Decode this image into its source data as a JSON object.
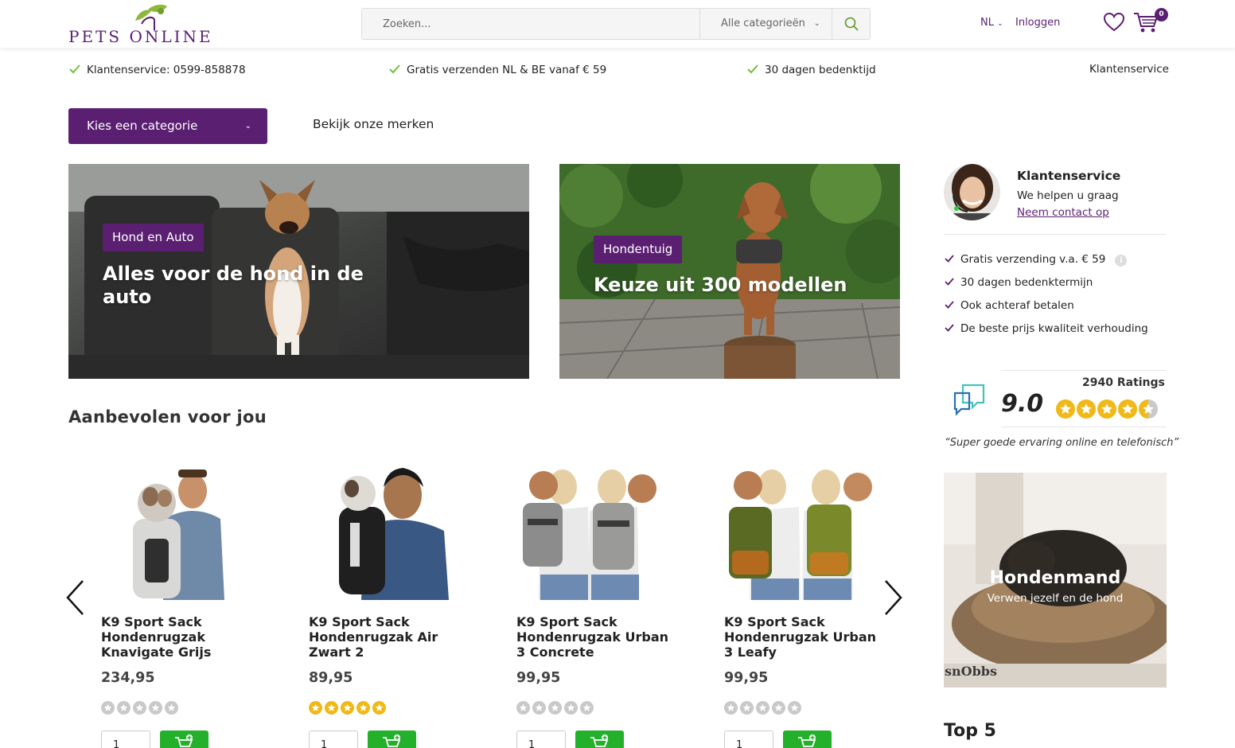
{
  "header": {
    "logo_text": "PETS ONLINE",
    "search_placeholder": "Zoeken...",
    "search_category": "Alle categorieën",
    "lang": "NL",
    "login": "Inloggen",
    "cart_count": "0"
  },
  "usp_bar": {
    "items": [
      "Klantenservice: 0599-858878",
      "Gratis verzenden NL & BE vanaf € 59",
      "30 dagen bedenktijd"
    ],
    "right_link": "Klantenservice"
  },
  "nav": {
    "category_button": "Kies een categorie",
    "brands_link": "Bekijk onze merken"
  },
  "banners": [
    {
      "label": "Hond en Auto",
      "title": "Alles voor de hond in de auto"
    },
    {
      "label": "Hondentuig",
      "title": "Keuze uit 300 modellen"
    }
  ],
  "recommended": {
    "title": "Aanbevolen voor jou",
    "products": [
      {
        "name": "K9 Sport Sack Hondenrugzak Knavigate Grijs",
        "price": "234,95",
        "rating": 0,
        "qty": "1"
      },
      {
        "name": "K9 Sport Sack Hondenrugzak Air Zwart 2",
        "price": "89,95",
        "rating": 5,
        "qty": "1"
      },
      {
        "name": "K9 Sport Sack Hondenrugzak Urban 3 Concrete",
        "price": "99,95",
        "rating": 0,
        "qty": "1"
      },
      {
        "name": "K9 Sport Sack Hondenrugzak Urban 3 Leafy",
        "price": "99,95",
        "rating": 0,
        "qty": "1"
      }
    ]
  },
  "sidebar": {
    "cs_title": "Klantenservice",
    "cs_sub": "We helpen u graag",
    "cs_link": "Neem contact op",
    "usps": [
      "Gratis verzending v.a. € 59",
      "30 dagen bedenktermijn",
      "Ook achteraf betalen",
      "De beste prijs kwaliteit verhouding"
    ],
    "rating_score": "9.0",
    "rating_count": "2940 Ratings",
    "rating_stars": 4.5,
    "quote": "“Super goede ervaring online en telefonisch”",
    "promo_title": "Hondenmand",
    "promo_sub": "Verwen jezelf en de hond",
    "promo_brand": "snObbs",
    "top5_title": "Top 5"
  },
  "colors": {
    "brand_purple": "#5b1f72",
    "cta_green": "#23b02a",
    "check_green": "#6fbf3a",
    "star_gold": "#f0b818"
  }
}
